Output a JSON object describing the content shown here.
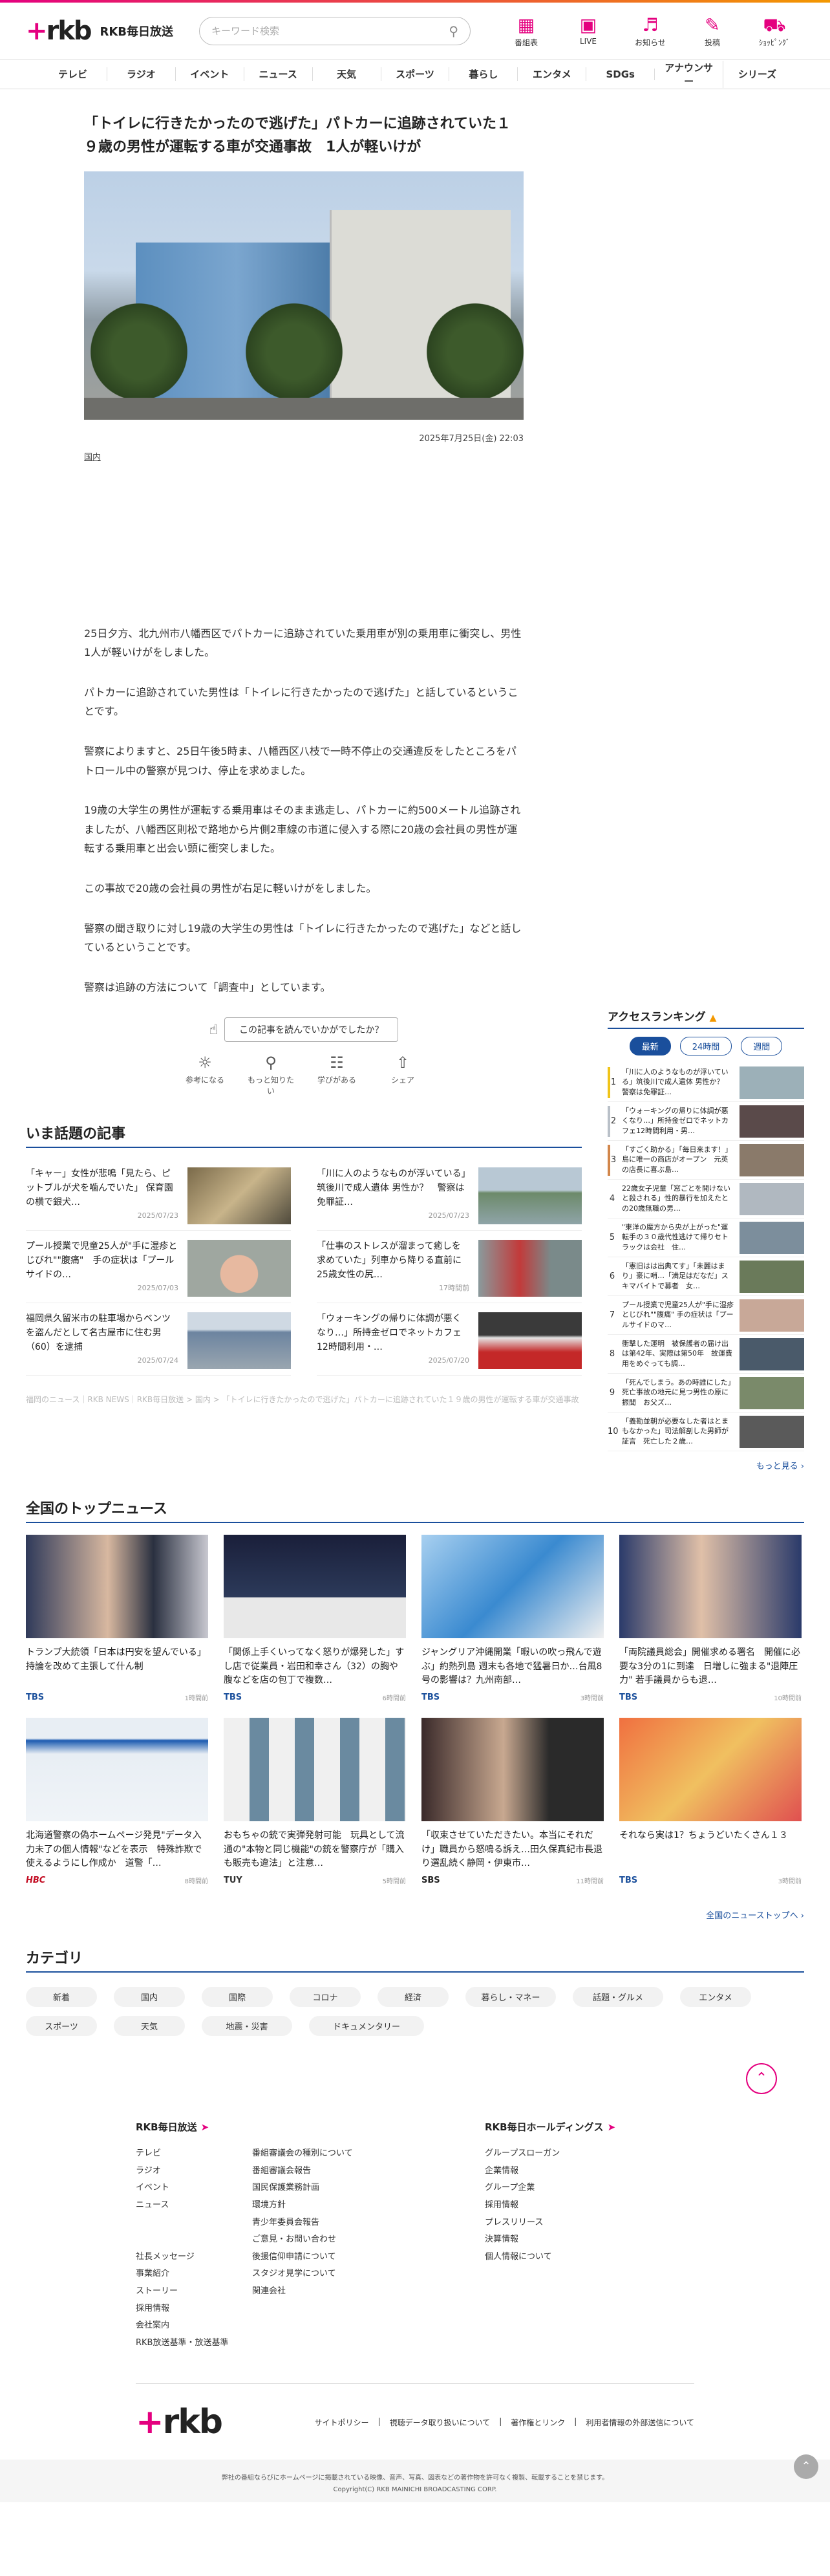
{
  "header": {
    "brand_name": "RKB毎日放送",
    "search_placeholder": "キーワード検索",
    "icons": [
      {
        "label": "番組表",
        "icon": "tv-guide-icon"
      },
      {
        "label": "LIVE",
        "icon": "live-icon"
      },
      {
        "label": "お知らせ",
        "icon": "bell-icon"
      },
      {
        "label": "投稿",
        "icon": "post-icon"
      },
      {
        "label": "ｼｮｯﾋﾟﾝｸﾞ",
        "icon": "cart-icon"
      }
    ]
  },
  "nav": [
    "テレビ",
    "ラジオ",
    "イベント",
    "ニュース",
    "天気",
    "スポーツ",
    "暮らし",
    "エンタメ",
    "SDGs",
    "アナウンサー",
    "シリーズ"
  ],
  "article": {
    "title": "「トイレに行きたかったので逃げた」パトカーに追跡されていた１９歳の男性が運転する車が交通事故　1人が軽いけが",
    "date": "2025年7月25日(金) 22:03",
    "category": "国内",
    "paragraphs": [
      "25日夕方、北九州市八幡西区でパトカーに追跡されていた乗用車が別の乗用車に衝突し、男性1人が軽いけがをしました。",
      "パトカーに追跡されていた男性は「トイレに行きたかったので逃げた」と話しているということです。",
      "警察によりますと、25日午後5時ま、八幡西区八枝で一時不停止の交通違反をしたところをパトロール中の警察が見つけ、停止を求めました。",
      "19歳の大学生の男性が運転する乗用車はそのまま逃走し、パトカーに約500メートル追跡されましたが、八幡西区則松で路地から片側2車線の市道に侵入する際に20歳の会社員の男性が運転する乗用車と出会い頭に衝突しました。",
      "この事故で20歳の会社員の男性が右足に軽いけがをしました。",
      "警察の聞き取りに対し19歳の大学生の男性は「トイレに行きたかったので逃げた」などと話しているということです。",
      "警察は追跡の方法について「調査中」としています。"
    ],
    "feedback_question": "この記事を読んでいかがでしたか？",
    "feedback_options": [
      {
        "label": "参考になる",
        "icon": "lightbulb-icon"
      },
      {
        "label": "もっと知りたい",
        "icon": "magnifier-icon"
      },
      {
        "label": "学びがある",
        "icon": "book-icon"
      },
      {
        "label": "シェア",
        "icon": "share-icon"
      }
    ]
  },
  "topics": {
    "title": "いま話題の記事",
    "items": [
      {
        "text": "「キャー」女性が悲鳴「見たら、ピットブルが犬を噛んでいた」 保育園の横で銀犬…",
        "time": "2025/07/23"
      },
      {
        "text": "「川に人のようなものが浮いている」筑後川で成人遺体 男性か？　警察は免罪証…",
        "time": "2025/07/23"
      },
      {
        "text": "プール授業で児童25人が\"手に湿疹とじびれ\"\"腹痛\"　手の症状は「プールサイドの…",
        "time": "2025/07/03"
      },
      {
        "text": "「仕事のストレスが溜まって癒しを求めていた」列車から降りる直前に25歳女性の尻…",
        "time": "17時間前"
      },
      {
        "text": "福岡県久留米市の駐車場からベンツを盗んだとして名古屋市に住む男（60）を逮捕",
        "time": "2025/07/24"
      },
      {
        "text": "「ウォーキングの帰りに体調が悪くなり…」所持金ゼロでネットカフェ12時間利用・…",
        "time": "2025/07/20"
      }
    ]
  },
  "breadcrumb": "福岡のニュース｜RKB NEWS｜RKB毎日放送 > 国内 > 「トイレに行きたかったので逃げた」パトカーに追跡されていた１９歳の男性が運転する車が交通事故　1人が軽いけが",
  "ranking": {
    "title": "アクセスランキング",
    "tabs": [
      "最新",
      "24時間",
      "週間"
    ],
    "items": [
      "「川に人のようなものが浮いている」筑後川で成人遺体 男性か？　警察は免罪証…",
      "「ウォーキングの帰りに体調が悪くなり…」所持金ゼロでネットカフェ12時間利用・男…",
      "「すごく助かる」「毎日来ます！」島に唯一の商店がオープン　元英の店長に喜ぶ島…",
      "22歳女子児童「窓ごとを開けないと殺される」性的暴行を加えたとの20歳無職の男…",
      "\"東洋の魔方から央が上がった\"運転手の３０歳代性逃けて帰りセトラックは会社　住…",
      "「憲旧はは出典てす」「未麗はまり」豪に哨…「満足はだなだ」スキマバイトで募者　女…",
      "プール授業で児童25人が\"手に湿疹とじびれ\"\"腹痛\" 手の症状は「プールサイドのマ…",
      "衝撃した運明　被保護者の届け出は第42年、実際は第50年　故運費用をめぐっても調…",
      "「死んでしまう。あの時誰にした」死亡事故の地元に見つ男性の原に振聞　お父ズ…",
      "「義勘並朝が必要なした者はとまもなかった」司法解剖した男師が証言　死亡した２歳…"
    ],
    "more": "もっと見る"
  },
  "top_news": {
    "title": "全国のトップニュース",
    "items": [
      {
        "text": "トランプ大統領「日本は円安を望んでいる」持論を改めて主張して什ん制",
        "source": "TBS",
        "ago": "1時間前"
      },
      {
        "text": "「関係上手くいってなく怒りが爆発した」すし店で従業員・岩田和幸さん（32）の胸や腹などを店の包丁で複数…",
        "source": "TBS",
        "ago": "6時間前"
      },
      {
        "text": "ジャングリア沖縄開業「暇いの吹っ飛んで遊ぶ」約熱列島 週末も各地で猛暑日か…台風8号の影響は？九州南部…",
        "source": "TBS",
        "ago": "3時間前"
      },
      {
        "text": "「両院議員総会」開催求める署名　開催に必要な3分の1に到達　日増しに強まる\"退陣圧力\" 若手議員からも退…",
        "source": "TBS",
        "ago": "10時間前"
      },
      {
        "text": "北海道警察の偽ホームページ発見\"データ入力未了の個人情報\"などを表示　特殊詐欺で使えるようにし作成か　道警「…",
        "source": "HBC",
        "ago": "8時間前"
      },
      {
        "text": "おもちゃの銃で実弾発射可能　玩具として流通の\"本物と同じ機能\"の銃を警察庁が「購入も販売も違法」と注意…",
        "source": "TUY",
        "ago": "5時間前"
      },
      {
        "text": "「収束させていただきたい。本当にそれだけ」職員から怒鳴る訴え…田久保真紀市長退り選乱続く静岡・伊東市…",
        "source": "SBS",
        "ago": "11時間前"
      },
      {
        "text": "それなら実は1？ちょうどいたくさん１３",
        "source": "TBS",
        "ago": "3時間前"
      }
    ],
    "more": "全国のニューストップへ"
  },
  "categories": {
    "title": "カテゴリ",
    "items": [
      "新着",
      "国内",
      "国際",
      "コロナ",
      "経済",
      "暮らし・マネー",
      "話題・グルメ",
      "エンタメ",
      "スポーツ",
      "天気",
      "地震・災害",
      "ドキュメンタリー"
    ]
  },
  "footer": {
    "col1_title": "RKB毎日放送",
    "col1_links": [
      "テレビ",
      "番組審議会の種別について",
      "ラジオ",
      "番組審議会報告",
      "イベント",
      "国民保護業務計画",
      "ニュース",
      "環境方針",
      "",
      "青少年委員会報告",
      "",
      "ご意見・お問い合わせ",
      "社長メッセージ",
      "後援信仰申請について",
      "事業紹介",
      "スタジオ見学について",
      "ストーリー",
      "関連会社",
      "採用情報",
      "",
      "会社案内",
      "",
      "RKB放送基準・放送基準",
      ""
    ],
    "col2_title": "RKB毎日ホールディングス",
    "col2_links": [
      "グループスローガン",
      "企業情報",
      "グループ企業",
      "採用情報",
      "プレスリリース",
      "決算情報",
      "個人情報について"
    ],
    "bottom_links": [
      "サイトポリシー",
      "視聴データ取り扱いについて",
      "著作権とリンク",
      "利用者情報の外部送信について"
    ],
    "notice": "弊社の番組ならびにホームページに掲載されている映像、音声、写真、図表などの著作物を許可なく複製、転載することを禁じます。",
    "copyright": "Copyright(C) RKB MAINICHI BROADCASTING CORP."
  },
  "colors": {
    "brand": "#e4007f",
    "navy": "#1a4f9c",
    "rank_gold": "#f0c419"
  }
}
